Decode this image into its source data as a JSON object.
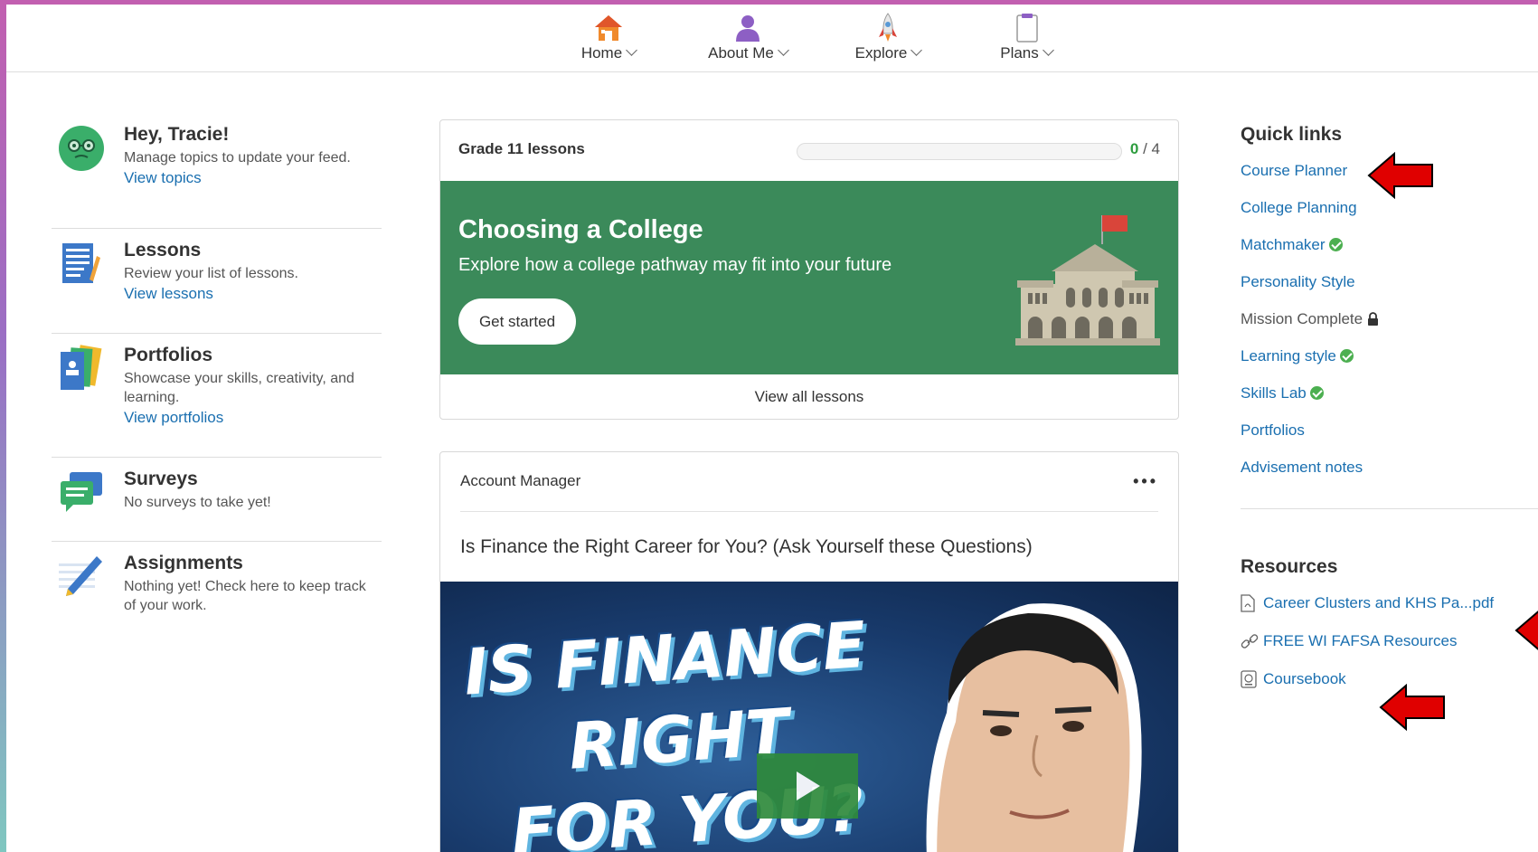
{
  "nav": {
    "items": [
      {
        "label": "Home",
        "icon": "house-icon"
      },
      {
        "label": "About Me",
        "icon": "person-icon"
      },
      {
        "label": "Explore",
        "icon": "rocket-icon"
      },
      {
        "label": "Plans",
        "icon": "clipboard-icon"
      }
    ]
  },
  "left": {
    "greeting": {
      "title": "Hey, Tracie!",
      "desc": "Manage topics to update your feed.",
      "link": "View topics"
    },
    "lessons": {
      "title": "Lessons",
      "desc": "Review your list of lessons.",
      "link": "View lessons"
    },
    "portfolios": {
      "title": "Portfolios",
      "desc": "Showcase your skills, creativity, and learning.",
      "link": "View portfolios"
    },
    "surveys": {
      "title": "Surveys",
      "desc": "No surveys to take yet!"
    },
    "assignments": {
      "title": "Assignments",
      "desc": "Nothing yet! Check here to keep track of your work."
    }
  },
  "lessons_card": {
    "header": "Grade 11 lessons",
    "progress_done": "0",
    "progress_total": " / 4",
    "progress_fraction": 0,
    "banner_title": "Choosing a College",
    "banner_sub": "Explore how a college pathway may fit into your future",
    "start_button": "Get started",
    "view_all": "View all lessons"
  },
  "post_card": {
    "author": "Account Manager",
    "more": "•••",
    "title": "Is Finance the Right Career for You? (Ask Yourself these Questions)",
    "video_text": [
      "IS FINANCE",
      "RIGHT",
      "FOR YOU?"
    ]
  },
  "quick_links": {
    "heading": "Quick links",
    "items": [
      {
        "label": "Course Planner",
        "status": "none"
      },
      {
        "label": "College Planning",
        "status": "none"
      },
      {
        "label": "Matchmaker",
        "status": "complete"
      },
      {
        "label": "Personality Style",
        "status": "none"
      },
      {
        "label": "Mission Complete",
        "status": "locked"
      },
      {
        "label": "Learning style",
        "status": "complete"
      },
      {
        "label": "Skills Lab",
        "status": "complete"
      },
      {
        "label": "Portfolios",
        "status": "none"
      },
      {
        "label": "Advisement notes",
        "status": "none"
      }
    ]
  },
  "resources": {
    "heading": "Resources",
    "items": [
      {
        "label": "Career Clusters and KHS Pa...pdf",
        "icon": "pdf-icon"
      },
      {
        "label": "FREE WI FAFSA Resources",
        "icon": "link-icon"
      },
      {
        "label": "Coursebook",
        "icon": "book-icon"
      }
    ]
  },
  "colors": {
    "accent_green": "#3b8a5a",
    "link_blue": "#1a6fb0",
    "check_green": "#4caf50",
    "annotation_red": "#e00000"
  }
}
